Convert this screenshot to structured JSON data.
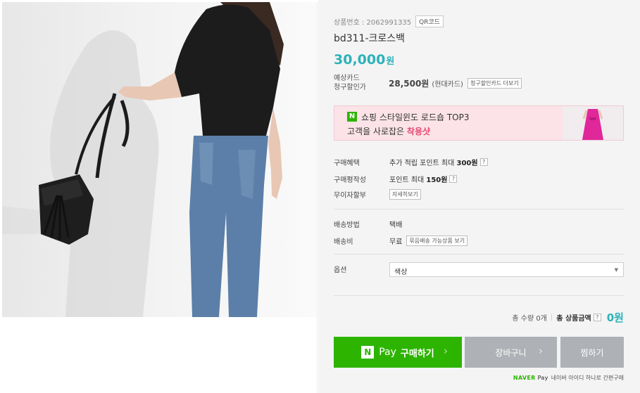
{
  "product": {
    "number_label": "상품번호 : 2062991335",
    "qr_label": "QR코드",
    "title": "bd311-크로스백",
    "price_value": "30,000",
    "price_unit": "원"
  },
  "card_discount": {
    "label_line1": "예상카드",
    "label_line2": "청구할인가",
    "amount": "28,500원",
    "issuer": "(현대카드)",
    "more_button": "청구할인카드 더보기"
  },
  "banner": {
    "badge": "N",
    "line1": "쇼핑 스타일윈도 로드숍 TOP3",
    "line2_prefix": "고객을 사로잡은 ",
    "line2_highlight": "착용샷"
  },
  "benefits": [
    {
      "key": "구매혜택",
      "text": "추가 적립 포인트 최대 ",
      "strong": "300원"
    },
    {
      "key": "구매평작성",
      "text": "포인트 최대 ",
      "strong": "150원"
    },
    {
      "key": "무이자할부",
      "button": "자세히보기"
    }
  ],
  "shipping": {
    "method_label": "배송방법",
    "method_value": "택배",
    "fee_label": "배송비",
    "fee_value": "무료",
    "bundle_button": "묶음배송 가능상품 보기"
  },
  "option": {
    "label": "옵션",
    "selected": "색상"
  },
  "total": {
    "qty_label": "총 수량 0개",
    "amount_label": "총 상품금액",
    "amount": "0원"
  },
  "buttons": {
    "pay_n": "N",
    "pay_text": "Pay",
    "buy": "구매하기",
    "cart": "장바구니",
    "wish": "찜하기"
  },
  "naver_pay": {
    "brand1": "NAVER",
    "brand2": "Pay",
    "note": "네이버 아이디 하나로 간편구매"
  },
  "colors": {
    "accent": "#2cb2b9",
    "naver_green": "#2db400",
    "button_gray": "#aeb2b6",
    "highlight_pink": "#e8476f"
  }
}
